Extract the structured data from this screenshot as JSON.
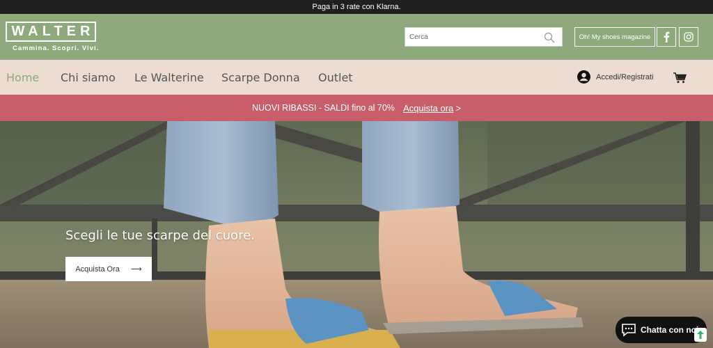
{
  "topbar": {
    "text": "Paga in 3 rate con Klarna."
  },
  "header": {
    "logo_text": "WALTER",
    "tagline": "Cammina. Scopri. Vivi.",
    "search_placeholder": "Cerca",
    "magazine_label": "Oh! My shoes magazine",
    "social": [
      "facebook-icon",
      "instagram-icon"
    ]
  },
  "nav": {
    "items": [
      {
        "label": "Home",
        "active": true
      },
      {
        "label": "Chi siamo"
      },
      {
        "label": "Le Walterine"
      },
      {
        "label": "Scarpe Donna"
      },
      {
        "label": "Outlet"
      }
    ],
    "account_label": "Accedi/Registrati"
  },
  "promo": {
    "text": "NUOVI RIBASSI - SALDI fino al 70%",
    "link": "Acquista ora",
    "arrow": ">"
  },
  "hero": {
    "title": "Scegli le tue scarpe del cuore.",
    "button_label": "Acquista Ora",
    "button_arrow": "⟶"
  },
  "chat": {
    "label": "Chatta con noi"
  },
  "colors": {
    "header": "#8eaa7d",
    "nav": "#eddcd2",
    "promo": "#c85e6a",
    "topbar": "#1f1f1f"
  }
}
